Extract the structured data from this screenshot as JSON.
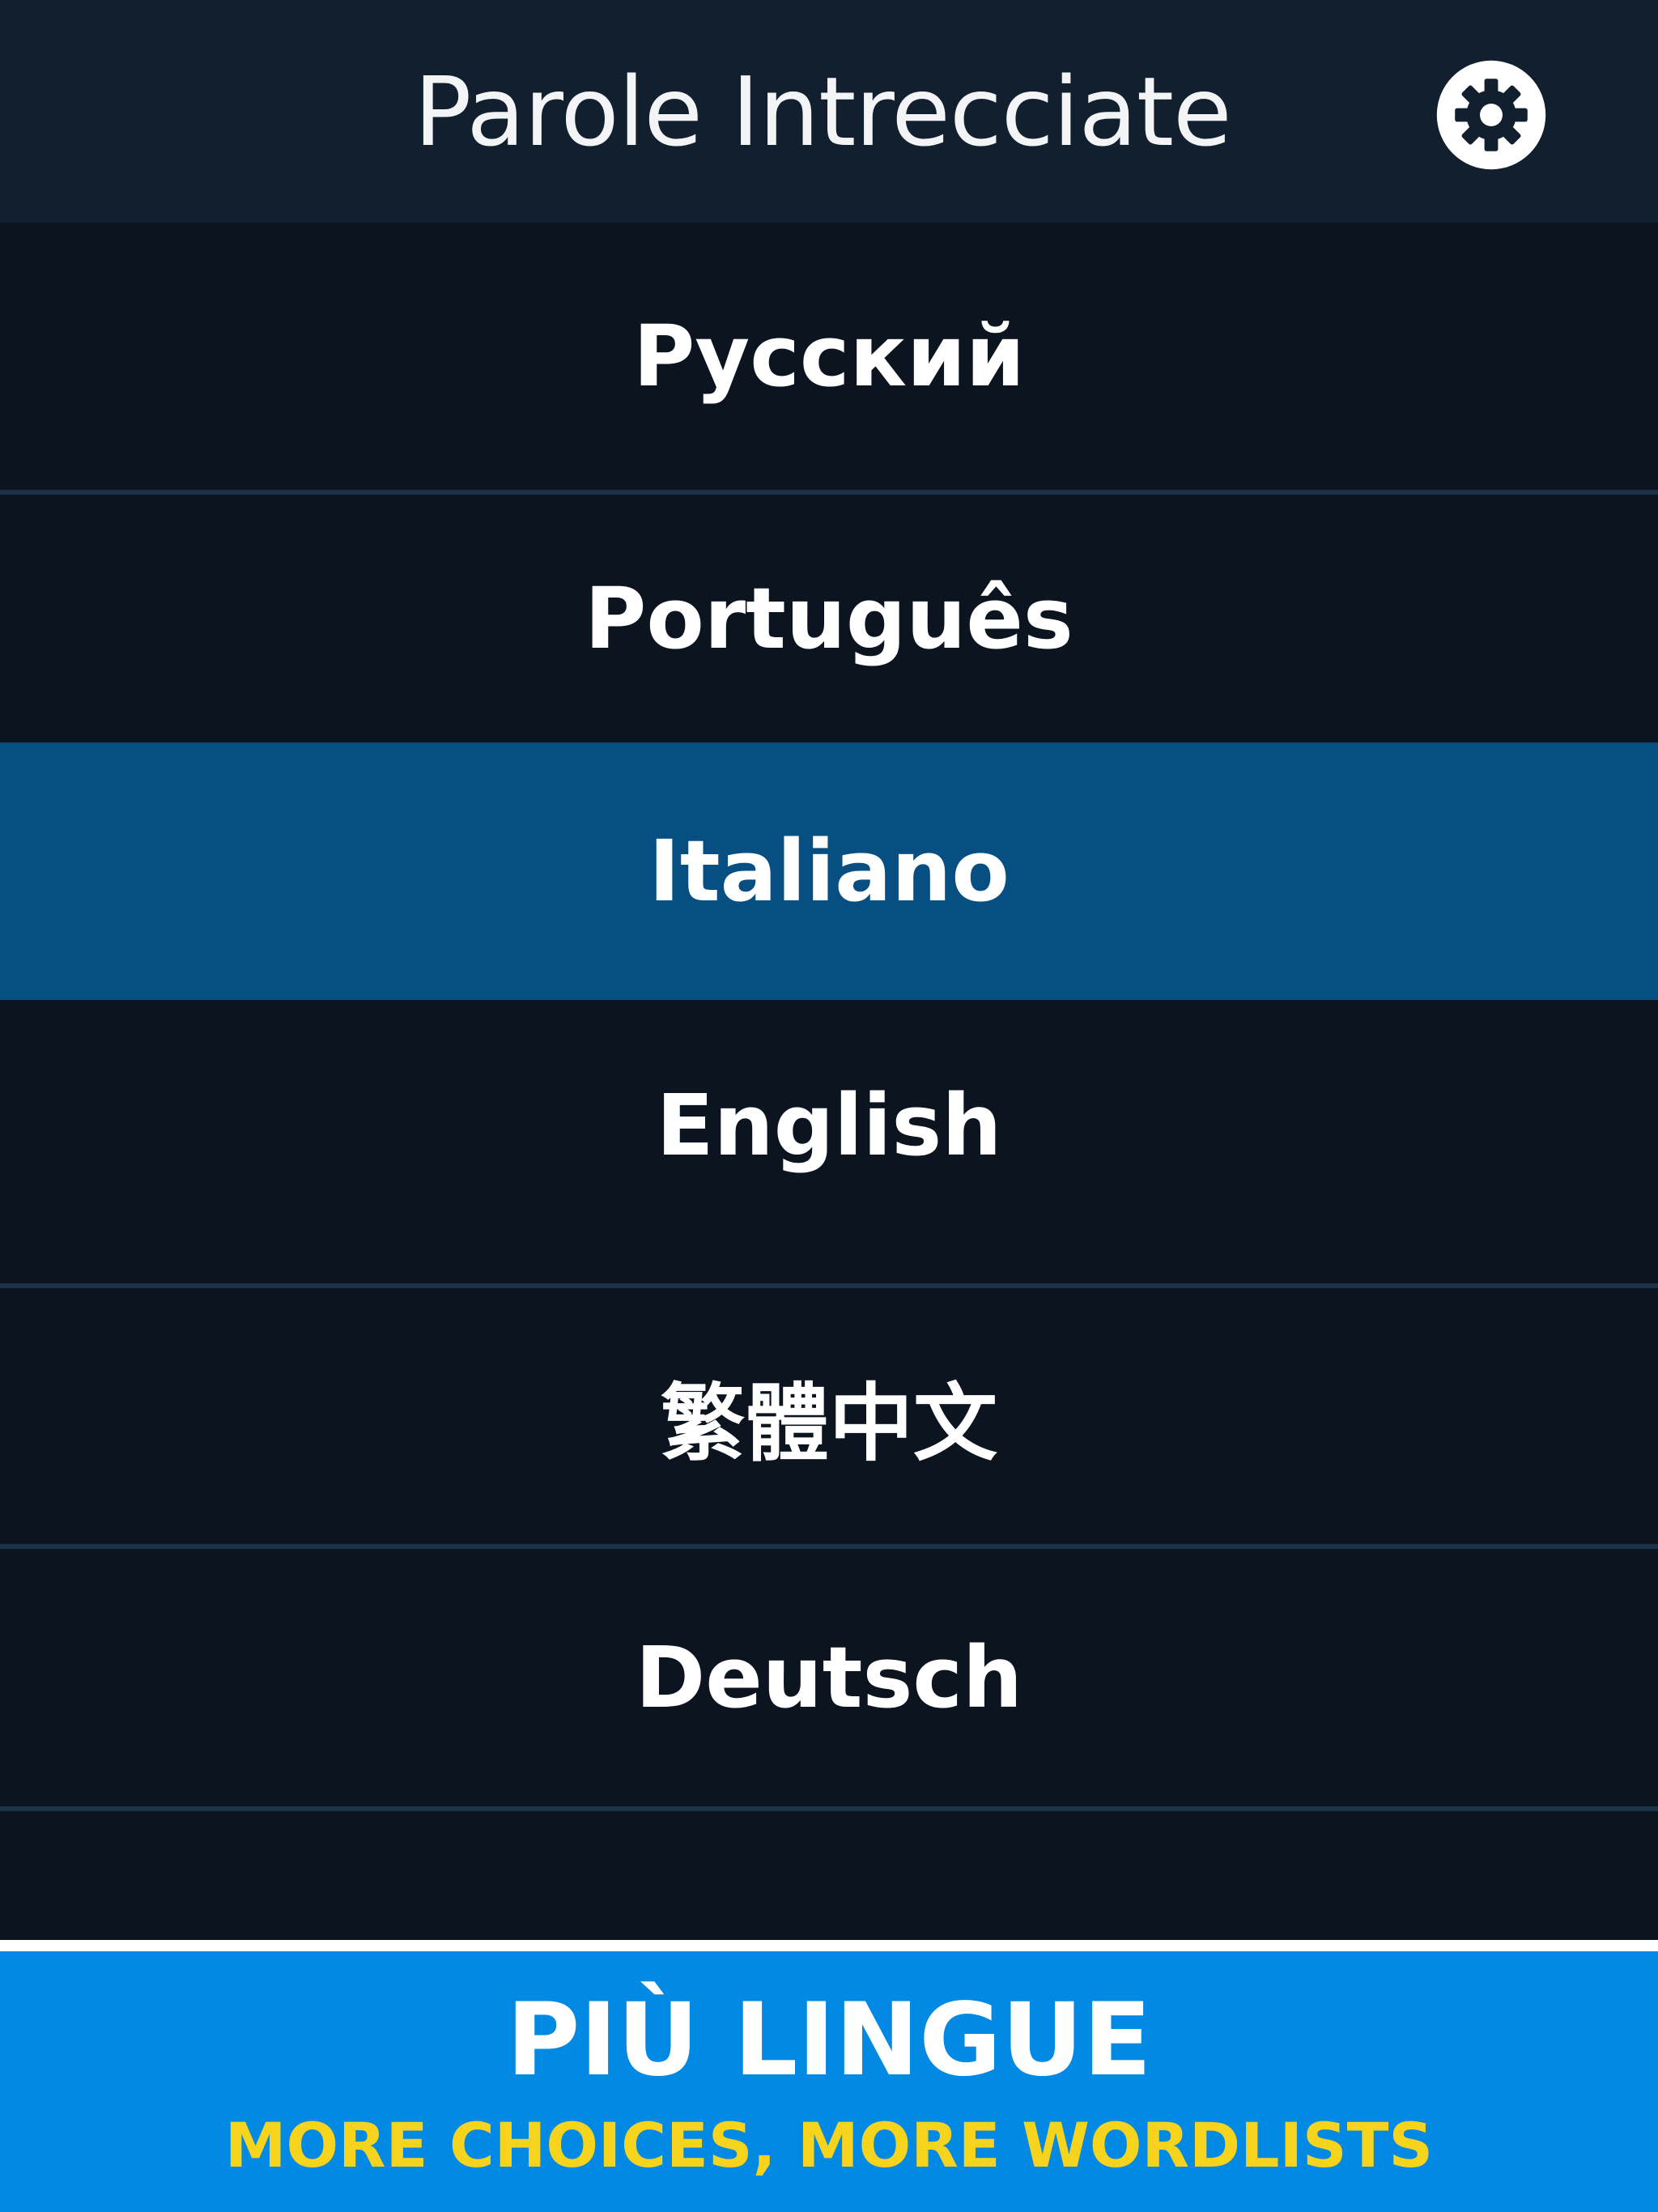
{
  "header": {
    "title": "Parole Intrecciate",
    "settings_icon": "gear-icon"
  },
  "languages": [
    {
      "label": "Русский",
      "selected": false
    },
    {
      "label": "Português",
      "selected": false
    },
    {
      "label": "Italiano",
      "selected": true
    },
    {
      "label": "English",
      "selected": false
    },
    {
      "label": "繁體中文",
      "selected": false
    },
    {
      "label": "Deutsch",
      "selected": false
    }
  ],
  "footer": {
    "title": "PIÙ LINGUE",
    "subtitle": "MORE CHOICES, MORE WORDLISTS"
  },
  "colors": {
    "background": "#0c151f",
    "header": "#121f2f",
    "selected": "#074f82",
    "footer": "#0289e4",
    "footer_subtitle": "#f6d31c"
  }
}
